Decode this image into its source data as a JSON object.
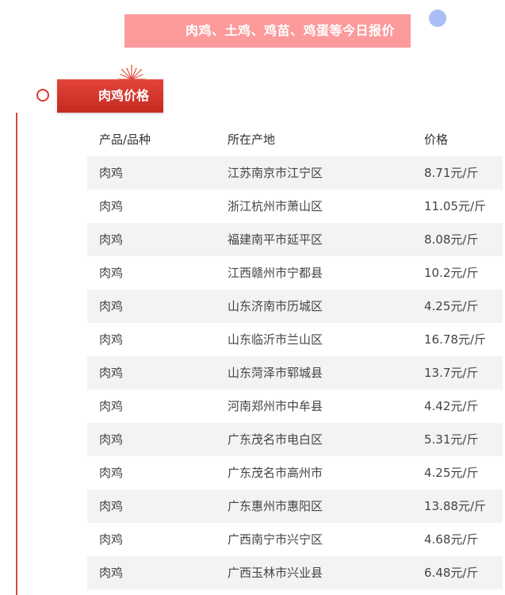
{
  "banner": {
    "title": "肉鸡、土鸡、鸡苗、鸡蛋等今日报价"
  },
  "section": {
    "title": "肉鸡价格"
  },
  "table": {
    "headers": [
      "产品/品种",
      "所在产地",
      "价格"
    ],
    "rows": [
      [
        "肉鸡",
        "江苏南京市江宁区",
        "8.71元/斤"
      ],
      [
        "肉鸡",
        "浙江杭州市萧山区",
        "11.05元/斤"
      ],
      [
        "肉鸡",
        "福建南平市延平区",
        "8.08元/斤"
      ],
      [
        "肉鸡",
        "江西赣州市宁都县",
        "10.2元/斤"
      ],
      [
        "肉鸡",
        "山东济南市历城区",
        "4.25元/斤"
      ],
      [
        "肉鸡",
        "山东临沂市兰山区",
        "16.78元/斤"
      ],
      [
        "肉鸡",
        "山东菏泽市郓城县",
        "13.7元/斤"
      ],
      [
        "肉鸡",
        "河南郑州市中牟县",
        "4.42元/斤"
      ],
      [
        "肉鸡",
        "广东茂名市电白区",
        "5.31元/斤"
      ],
      [
        "肉鸡",
        "广东茂名市高州市",
        "4.25元/斤"
      ],
      [
        "肉鸡",
        "广东惠州市惠阳区",
        "13.88元/斤"
      ],
      [
        "肉鸡",
        "广西南宁市兴宁区",
        "4.68元/斤"
      ],
      [
        "肉鸡",
        "广西玉林市兴业县",
        "6.48元/斤"
      ]
    ]
  },
  "colors": {
    "banner_bg": "#fc9a9c",
    "accent_red": "#d63a2f",
    "dot_blue": "#a9bef5",
    "row_alt_bg": "#f3f3f3"
  }
}
